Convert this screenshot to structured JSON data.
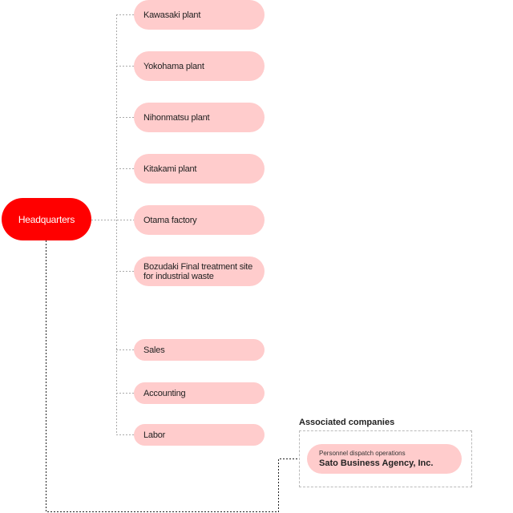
{
  "headquarters": {
    "label": "Headquarters",
    "color": "#ff0000"
  },
  "units": [
    {
      "label": "Kawasaki plant"
    },
    {
      "label": "Yokohama plant"
    },
    {
      "label": "Nihonmatsu plant"
    },
    {
      "label": "Kitakami plant"
    },
    {
      "label": "Otama factory"
    },
    {
      "label": "Bozudaki Final treatment site for industrial waste"
    },
    {
      "label": "Sales"
    },
    {
      "label": "Accounting"
    },
    {
      "label": "Labor"
    }
  ],
  "associated": {
    "title": "Associated companies",
    "company": {
      "description": "Personnel dispatch operations",
      "name": "Sato Business Agency, Inc."
    }
  },
  "colors": {
    "node_fill": "#ffcccc",
    "hq_fill": "#ff0000"
  }
}
